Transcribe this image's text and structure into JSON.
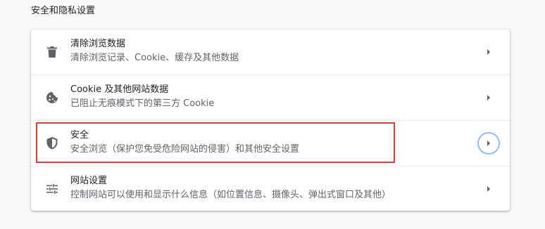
{
  "section": {
    "title": "安全和隐私设置"
  },
  "rows": [
    {
      "title": "清除浏览数据",
      "subtitle": "清除浏览记录、Cookie、缓存及其他数据",
      "icon": "trash-icon"
    },
    {
      "title": "Cookie 及其他网站数据",
      "subtitle": "已阻止无痕模式下的第三方 Cookie",
      "icon": "cookie-icon"
    },
    {
      "title": "安全",
      "subtitle": "安全浏览（保护您免受危险网站的侵害）和其他安全设置",
      "icon": "shield-icon"
    },
    {
      "title": "网站设置",
      "subtitle": "控制网站可以使用和显示什么信息（如位置信息、摄像头、弹出式窗口及其他）",
      "icon": "tune-icon"
    }
  ],
  "colors": {
    "background": "#f8f9fa",
    "card": "#ffffff",
    "primary_text": "#202124",
    "secondary_text": "#5f6368",
    "icon": "#5f6368",
    "highlight_border": "#e03c3c",
    "focus_ring": "#8ab4f8"
  }
}
